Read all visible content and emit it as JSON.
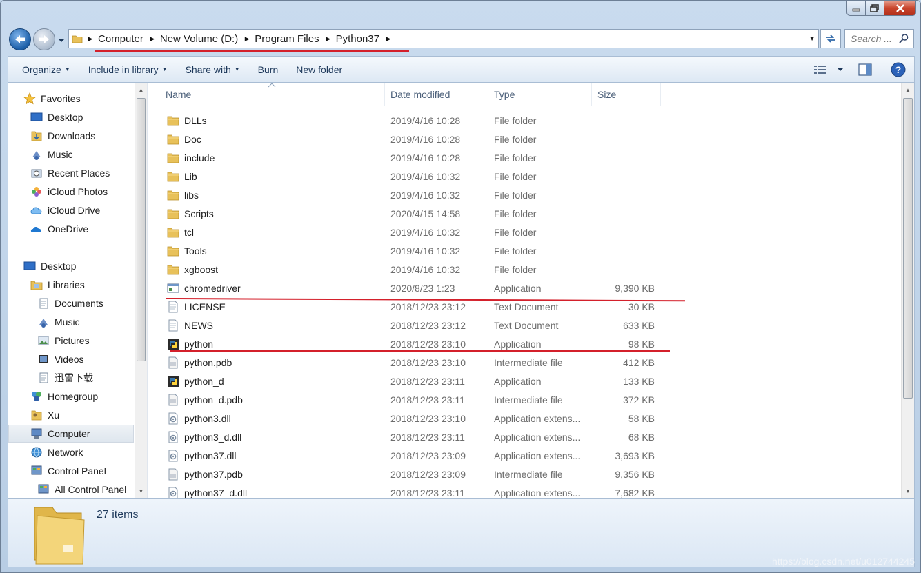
{
  "window": {
    "title": "Python37"
  },
  "breadcrumbs": [
    "Computer",
    "New Volume (D:)",
    "Program Files",
    "Python37"
  ],
  "search": {
    "placeholder": "Search ..."
  },
  "toolbar": {
    "items": [
      "Organize",
      "Include in library",
      "Share with",
      "Burn",
      "New folder"
    ]
  },
  "navpane": {
    "items": [
      {
        "label": "Favorites",
        "icon": "star-icon"
      },
      {
        "label": "Desktop",
        "icon": "desktop-icon"
      },
      {
        "label": "Downloads",
        "icon": "downloads-icon"
      },
      {
        "label": "Music",
        "icon": "music-icon"
      },
      {
        "label": "Recent Places",
        "icon": "recent-icon"
      },
      {
        "label": "iCloud Photos",
        "icon": "icloud-photos-icon"
      },
      {
        "label": "iCloud Drive",
        "icon": "icloud-drive-icon"
      },
      {
        "label": "OneDrive",
        "icon": "onedrive-icon"
      },
      {
        "label": "Desktop",
        "icon": "desktop-icon"
      },
      {
        "label": "Libraries",
        "icon": "libraries-icon"
      },
      {
        "label": "Documents",
        "icon": "documents-icon"
      },
      {
        "label": "Music",
        "icon": "music-icon"
      },
      {
        "label": "Pictures",
        "icon": "pictures-icon"
      },
      {
        "label": "Videos",
        "icon": "videos-icon"
      },
      {
        "label": "迅雷下载",
        "icon": "folder-icon"
      },
      {
        "label": "Homegroup",
        "icon": "homegroup-icon"
      },
      {
        "label": "Xu",
        "icon": "user-folder-icon"
      },
      {
        "label": "Computer",
        "icon": "computer-icon"
      },
      {
        "label": "Network",
        "icon": "network-icon"
      },
      {
        "label": "Control Panel",
        "icon": "control-panel-icon"
      },
      {
        "label": "All Control Panel",
        "icon": "control-panel-icon"
      }
    ]
  },
  "columns": [
    "Name",
    "Date modified",
    "Type",
    "Size"
  ],
  "files": [
    {
      "name": "DLLs",
      "date": "2019/4/16 10:28",
      "type": "File folder",
      "size": "",
      "icon": "folder-icon"
    },
    {
      "name": "Doc",
      "date": "2019/4/16 10:28",
      "type": "File folder",
      "size": "",
      "icon": "folder-icon"
    },
    {
      "name": "include",
      "date": "2019/4/16 10:28",
      "type": "File folder",
      "size": "",
      "icon": "folder-icon"
    },
    {
      "name": "Lib",
      "date": "2019/4/16 10:32",
      "type": "File folder",
      "size": "",
      "icon": "folder-icon"
    },
    {
      "name": "libs",
      "date": "2019/4/16 10:32",
      "type": "File folder",
      "size": "",
      "icon": "folder-icon"
    },
    {
      "name": "Scripts",
      "date": "2020/4/15 14:58",
      "type": "File folder",
      "size": "",
      "icon": "folder-icon"
    },
    {
      "name": "tcl",
      "date": "2019/4/16 10:32",
      "type": "File folder",
      "size": "",
      "icon": "folder-icon"
    },
    {
      "name": "Tools",
      "date": "2019/4/16 10:32",
      "type": "File folder",
      "size": "",
      "icon": "folder-icon"
    },
    {
      "name": "xgboost",
      "date": "2019/4/16 10:32",
      "type": "File folder",
      "size": "",
      "icon": "folder-icon"
    },
    {
      "name": "chromedriver",
      "date": "2020/8/23 1:23",
      "type": "Application",
      "size": "9,390 KB",
      "icon": "application-icon"
    },
    {
      "name": "LICENSE",
      "date": "2018/12/23 23:12",
      "type": "Text Document",
      "size": "30 KB",
      "icon": "text-document-icon"
    },
    {
      "name": "NEWS",
      "date": "2018/12/23 23:12",
      "type": "Text Document",
      "size": "633 KB",
      "icon": "text-document-icon"
    },
    {
      "name": "python",
      "date": "2018/12/23 23:10",
      "type": "Application",
      "size": "98 KB",
      "icon": "python-icon"
    },
    {
      "name": "python.pdb",
      "date": "2018/12/23 23:10",
      "type": "Intermediate file",
      "size": "412 KB",
      "icon": "pdb-file-icon"
    },
    {
      "name": "python_d",
      "date": "2018/12/23 23:11",
      "type": "Application",
      "size": "133 KB",
      "icon": "python-icon"
    },
    {
      "name": "python_d.pdb",
      "date": "2018/12/23 23:11",
      "type": "Intermediate file",
      "size": "372 KB",
      "icon": "pdb-file-icon"
    },
    {
      "name": "python3.dll",
      "date": "2018/12/23 23:10",
      "type": "Application extens...",
      "size": "58 KB",
      "icon": "dll-file-icon"
    },
    {
      "name": "python3_d.dll",
      "date": "2018/12/23 23:11",
      "type": "Application extens...",
      "size": "68 KB",
      "icon": "dll-file-icon"
    },
    {
      "name": "python37.dll",
      "date": "2018/12/23 23:09",
      "type": "Application extens...",
      "size": "3,693 KB",
      "icon": "dll-file-icon"
    },
    {
      "name": "python37.pdb",
      "date": "2018/12/23 23:09",
      "type": "Intermediate file",
      "size": "9,356 KB",
      "icon": "pdb-file-icon"
    },
    {
      "name": "python37_d.dll",
      "date": "2018/12/23 23:11",
      "type": "Application extens...",
      "size": "7,682 KB",
      "icon": "dll-file-icon"
    }
  ],
  "details": {
    "item_count": "27 items"
  },
  "watermark": "https://blog.csdn.net/u012744245",
  "colors": {
    "annotation_red": "#d4202b",
    "accent_blue": "#1e395b"
  }
}
